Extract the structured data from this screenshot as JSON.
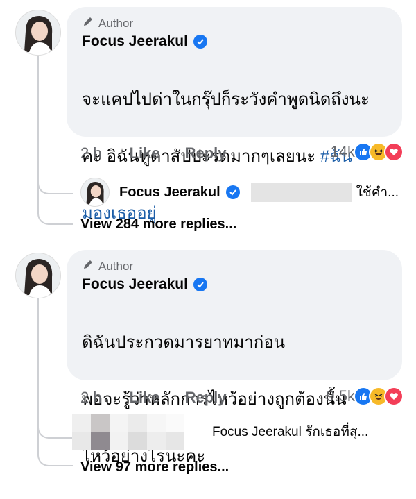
{
  "comments": [
    {
      "author_badge": "Author",
      "name": "Focus Jeerakul",
      "text_line1": "จะแคปไปด่าในกรุ๊ปก็ระวังคำพูดนิดถึงนะ",
      "text_line2_prefix": "คะ อิฉันหูตาสัปปะรดมากๆเลยนะ ",
      "hashtag_part1": "#ฉัน",
      "hashtag_part2": "มองเธออยู่",
      "time": "2 h",
      "like_label": "Like",
      "reply_label": "Reply",
      "reaction_count": "14k",
      "reply_preview": {
        "name": "Focus Jeerakul",
        "snippet": "ใช้คำ..."
      },
      "view_more": "View 284 more replies..."
    },
    {
      "author_badge": "Author",
      "name": "Focus Jeerakul",
      "text_line1": "ดิฉันประกวดมารยาทมาก่อน",
      "text_line2": "พอจะรู้ว่าหลักการไหว้อย่างถูกต้องนั้น",
      "text_line3": "ไหว้อย่างไรนะคะ",
      "time": "2 h",
      "like_label": "Like",
      "reply_label": "Reply",
      "reaction_count": "9.5k",
      "reply_preview": {
        "snippet": "Focus Jeerakul รักเธอที่สุ..."
      },
      "view_more": "View 97 more replies..."
    }
  ],
  "colors": {
    "bubble": "#f0f2f5",
    "like_blue": "#1877f2",
    "haha_yellow": "#f7b928",
    "love_red": "#f33e58",
    "hashtag": "#1c5ea8",
    "muted": "#65676b"
  },
  "icons": [
    "pencil-icon",
    "verified-badge-icon",
    "like-reaction-icon",
    "haha-reaction-icon",
    "love-reaction-icon"
  ]
}
